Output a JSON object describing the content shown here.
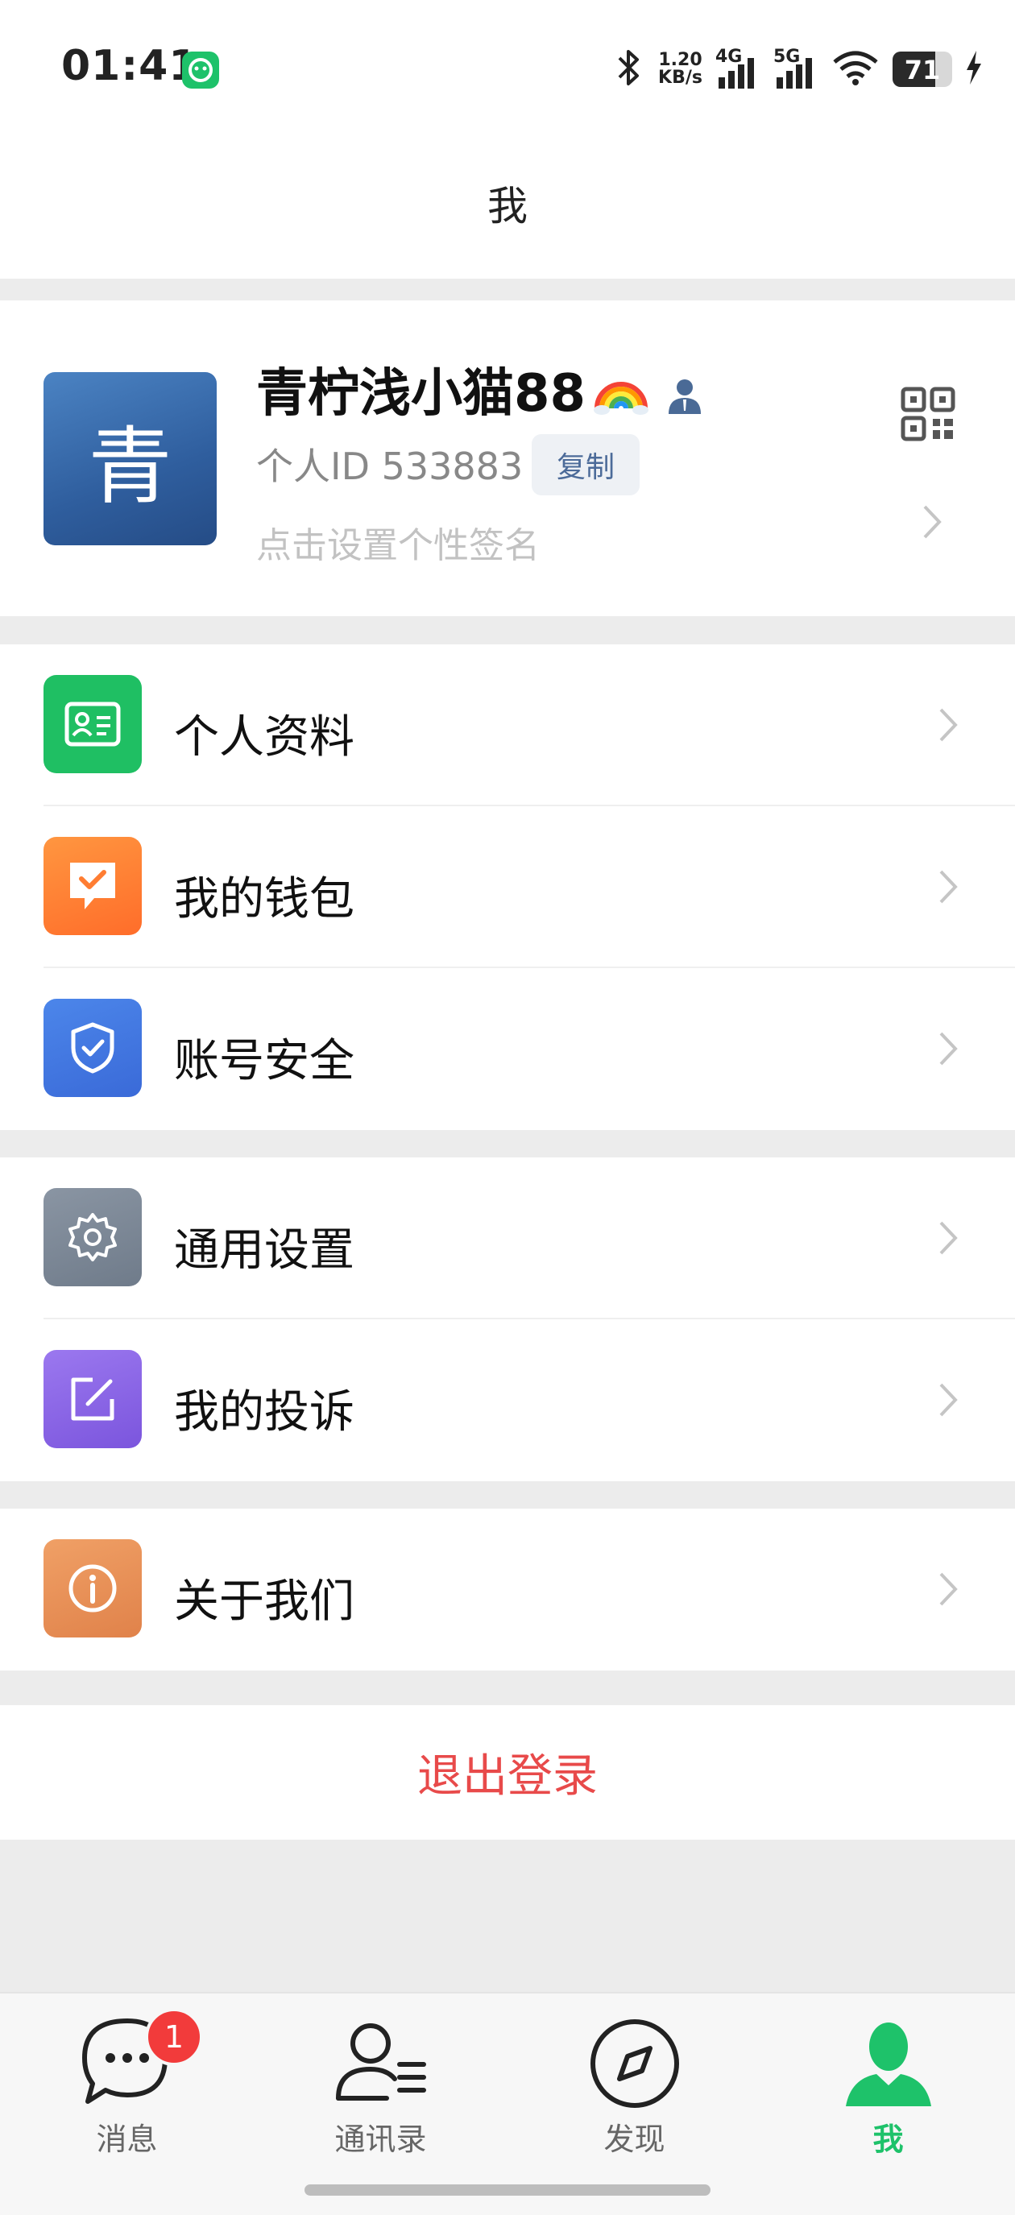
{
  "status_bar": {
    "time": "01:41",
    "net_speed_value": "1.20",
    "net_speed_unit": "KB/s",
    "net_4g": "4G",
    "net_5g": "5G",
    "battery_percent": "71",
    "battery_level": 0.71
  },
  "header": {
    "title": "我"
  },
  "profile": {
    "avatar_text": "青",
    "name": "青柠浅小猫88",
    "id_label": "个人ID 533883",
    "copy_label": "复制",
    "signature_placeholder": "点击设置个性签名"
  },
  "menu_groups": [
    {
      "items": [
        {
          "label": "个人资料",
          "icon": "id-card-icon",
          "color": "#1fbf63"
        },
        {
          "label": "我的钱包",
          "icon": "wallet-icon",
          "color": "#ff7d32"
        },
        {
          "label": "账号安全",
          "icon": "shield-icon",
          "color": "#3f78e3"
        }
      ]
    },
    {
      "items": [
        {
          "label": "通用设置",
          "icon": "gear-icon",
          "color": "#7d8896"
        },
        {
          "label": "我的投诉",
          "icon": "edit-icon",
          "color": "#8a63e6"
        }
      ]
    },
    {
      "items": [
        {
          "label": "关于我们",
          "icon": "info-icon",
          "color": "#ea9051"
        }
      ]
    }
  ],
  "logout_label": "退出登录",
  "colors": {
    "accent": "#1ec26a",
    "logout": "#e84a4a",
    "badge": "#f23b3b"
  },
  "tab_bar": {
    "tabs": [
      {
        "label": "消息",
        "icon": "chat-bubble-icon",
        "badge": "1"
      },
      {
        "label": "通讯录",
        "icon": "contacts-icon"
      },
      {
        "label": "发现",
        "icon": "compass-icon"
      },
      {
        "label": "我",
        "icon": "person-icon",
        "active": true
      }
    ]
  }
}
